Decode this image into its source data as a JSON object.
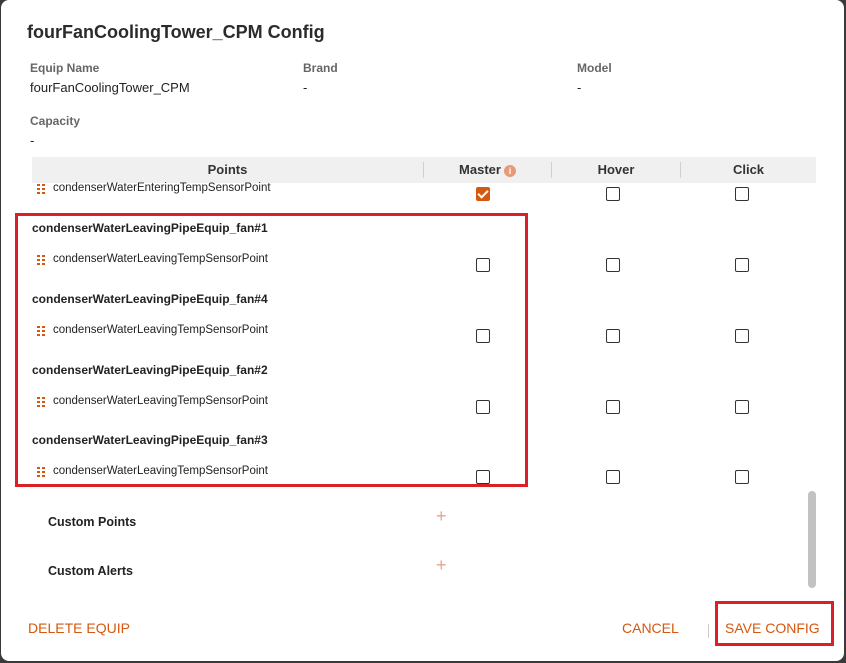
{
  "dialog": {
    "title": "fourFanCoolingTower_CPM Config"
  },
  "equip_info": {
    "equip_name_label": "Equip Name",
    "equip_name_value": "fourFanCoolingTower_CPM",
    "brand_label": "Brand",
    "brand_value": "-",
    "model_label": "Model",
    "model_value": "-",
    "capacity_label": "Capacity",
    "capacity_value": "-"
  },
  "table": {
    "headers": {
      "points": "Points",
      "master": "Master",
      "hover": "Hover",
      "click": "Click"
    },
    "top_row": {
      "label": "condenserWaterEnteringTempSensorPoint",
      "master": true,
      "hover": false,
      "click": false
    },
    "groups": [
      {
        "name": "condenserWaterLeavingPipeEquip_fan#1",
        "point": "condenserWaterLeavingTempSensorPoint",
        "master": false,
        "hover": false,
        "click": false
      },
      {
        "name": "condenserWaterLeavingPipeEquip_fan#4",
        "point": "condenserWaterLeavingTempSensorPoint",
        "master": false,
        "hover": false,
        "click": false
      },
      {
        "name": "condenserWaterLeavingPipeEquip_fan#2",
        "point": "condenserWaterLeavingTempSensorPoint",
        "master": false,
        "hover": false,
        "click": false
      },
      {
        "name": "condenserWaterLeavingPipeEquip_fan#3",
        "point": "condenserWaterLeavingTempSensorPoint",
        "master": false,
        "hover": false,
        "click": false
      }
    ]
  },
  "custom": {
    "points_label": "Custom Points",
    "alerts_label": "Custom Alerts",
    "add_symbol": "+"
  },
  "footer": {
    "delete_label": "DELETE EQUIP",
    "cancel_label": "CANCEL",
    "save_label": "SAVE CONFIG"
  },
  "colors": {
    "accent": "#d4580f",
    "highlight": "#d92028"
  },
  "icons": {
    "master_info": "info-icon",
    "drag_handle": "grip-icon"
  }
}
